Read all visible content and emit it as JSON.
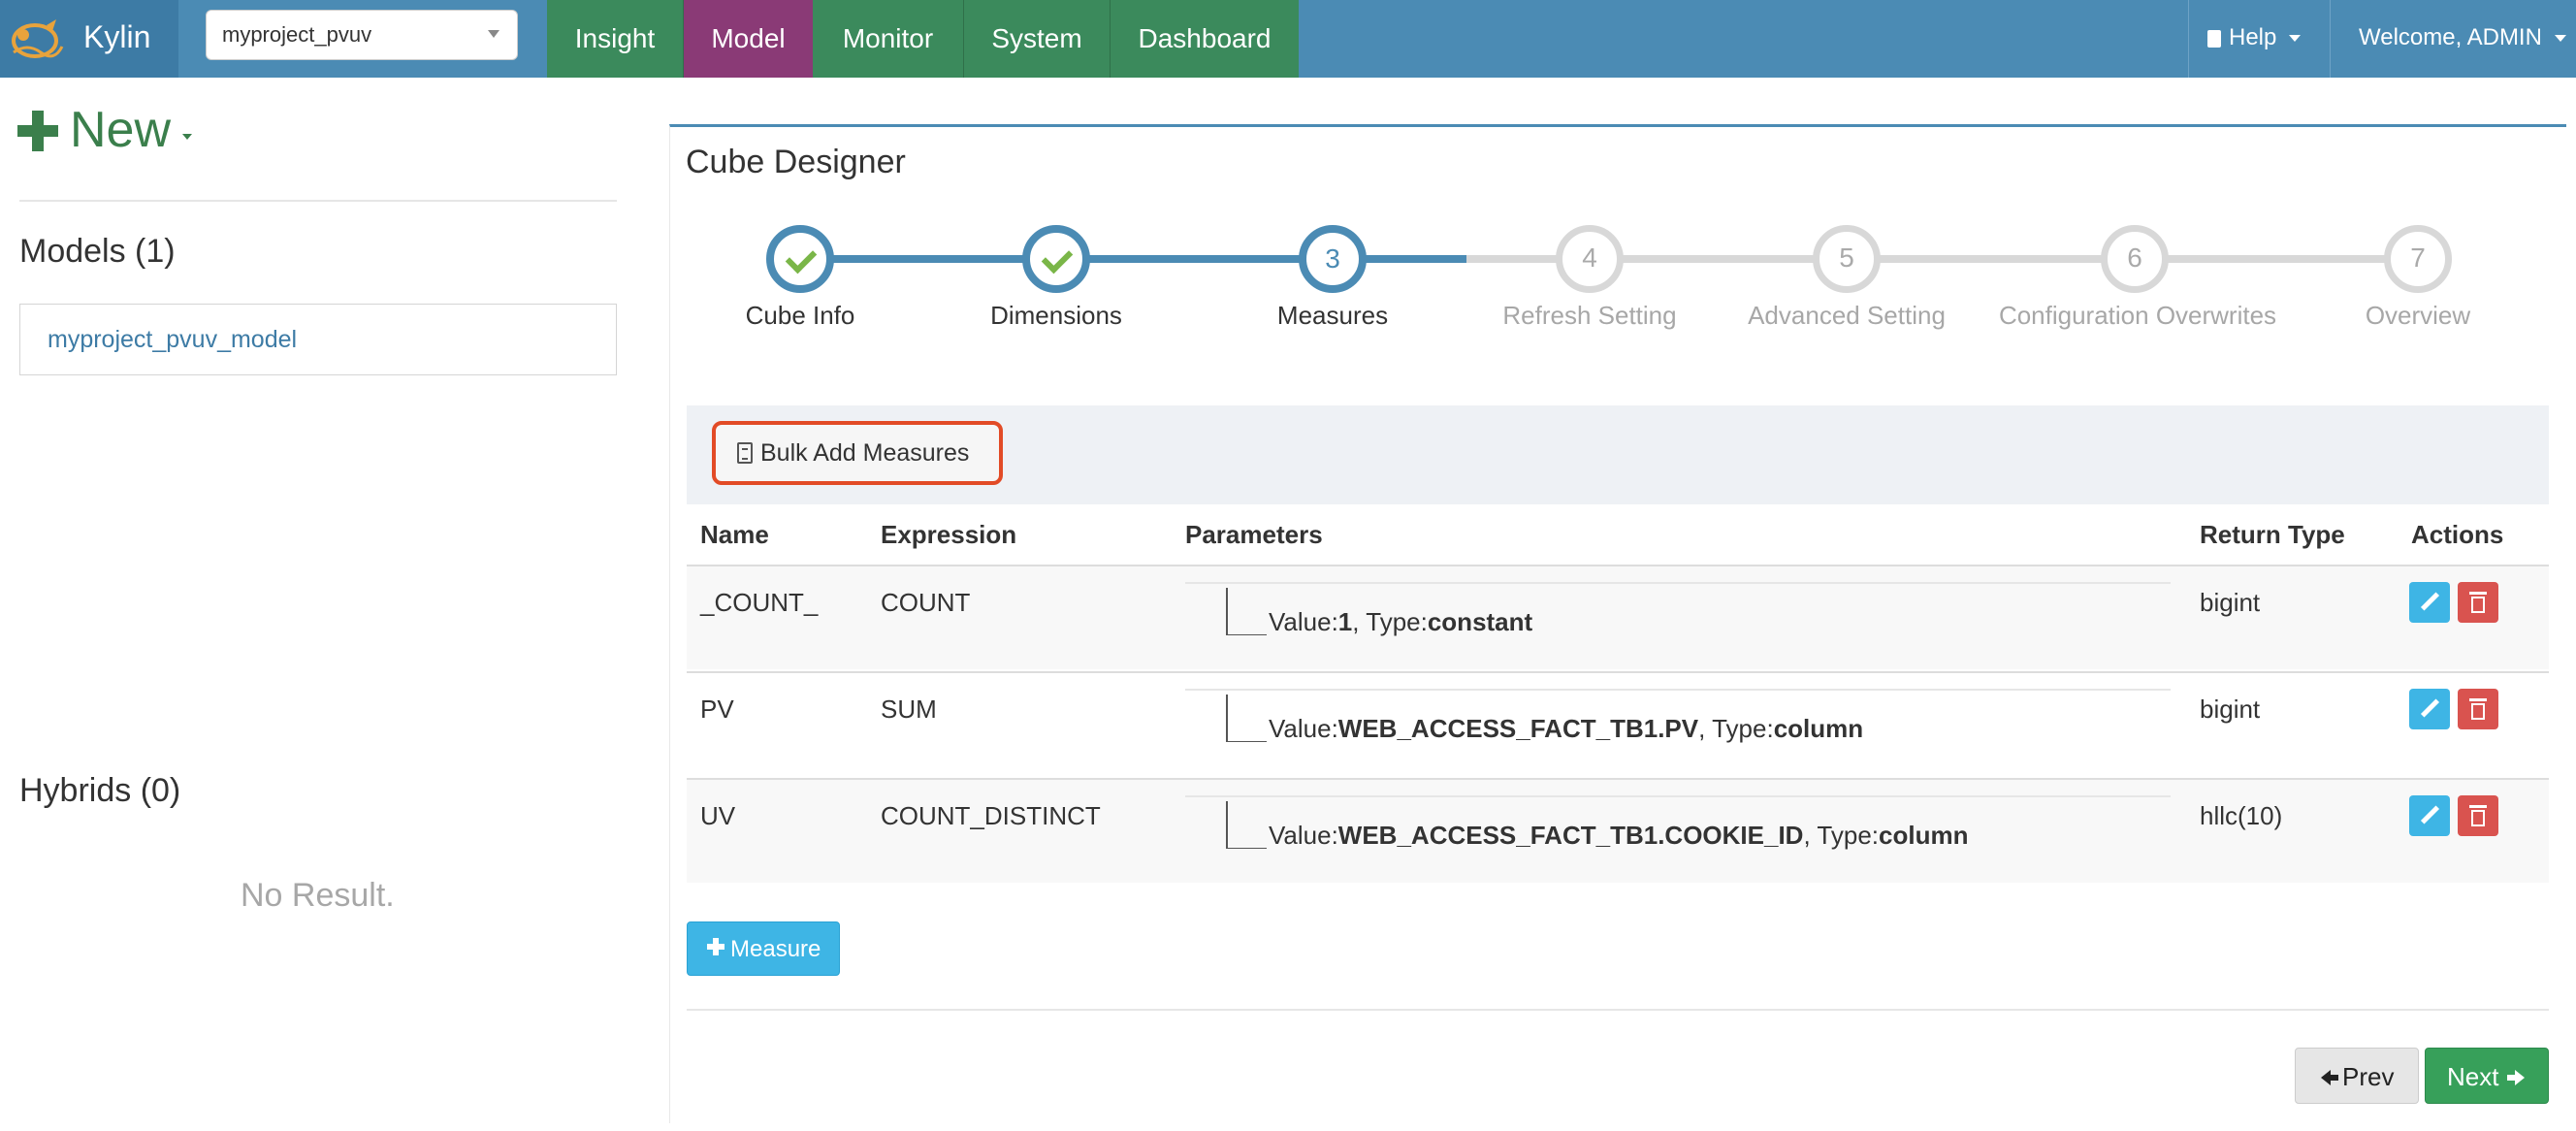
{
  "app": {
    "brand": "Kylin"
  },
  "project_select": {
    "value": "myproject_pvuv"
  },
  "nav": {
    "tabs": [
      "Insight",
      "Model",
      "Monitor",
      "System",
      "Dashboard"
    ],
    "help": "Help",
    "welcome": "Welcome, ADMIN"
  },
  "sidebar": {
    "new_label": "New",
    "models_title": "Models (1)",
    "models": [
      "myproject_pvuv_model"
    ],
    "hybrids_title": "Hybrids (0)",
    "no_result": "No Result."
  },
  "designer": {
    "title": "Cube Designer",
    "steps": [
      {
        "number": "1",
        "label": "Cube Info",
        "state": "done"
      },
      {
        "number": "2",
        "label": "Dimensions",
        "state": "done"
      },
      {
        "number": "3",
        "label": "Measures",
        "state": "active"
      },
      {
        "number": "4",
        "label": "Refresh Setting",
        "state": "todo"
      },
      {
        "number": "5",
        "label": "Advanced Setting",
        "state": "todo"
      },
      {
        "number": "6",
        "label": "Configuration Overwrites",
        "state": "todo"
      },
      {
        "number": "7",
        "label": "Overview",
        "state": "todo"
      }
    ],
    "bulk_add_label": "Bulk Add Measures",
    "table": {
      "headers": {
        "name": "Name",
        "expression": "Expression",
        "parameters": "Parameters",
        "return_type": "Return Type",
        "actions": "Actions"
      },
      "rows": [
        {
          "name": "_COUNT_",
          "expression": "COUNT",
          "value": "1",
          "type": "constant",
          "return_type": "bigint"
        },
        {
          "name": "PV",
          "expression": "SUM",
          "value": "WEB_ACCESS_FACT_TB1.PV",
          "type": "column",
          "return_type": "bigint"
        },
        {
          "name": "UV",
          "expression": "COUNT_DISTINCT",
          "value": "WEB_ACCESS_FACT_TB1.COOKIE_ID",
          "type": "column",
          "return_type": "hllc(10)"
        }
      ],
      "value_prefix": "Value:",
      "type_prefix": ", Type:"
    },
    "add_measure_label": "Measure",
    "prev_label": "Prev",
    "next_label": "Next"
  },
  "colors": {
    "nav_blue": "#4b8bb4",
    "nav_green": "#3b8a5c",
    "nav_model": "#8a3a76",
    "new_green": "#3b7f4c",
    "highlight": "#e24b26"
  }
}
